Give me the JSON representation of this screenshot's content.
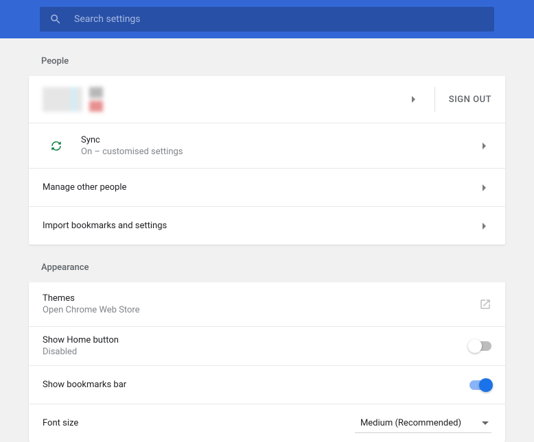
{
  "search": {
    "placeholder": "Search settings"
  },
  "sections": {
    "people": {
      "header": "People",
      "sign_out": "SIGN OUT",
      "sync": {
        "title": "Sync",
        "subtitle": "On – customised settings"
      },
      "manage_other": "Manage other people",
      "import_bookmarks": "Import bookmarks and settings"
    },
    "appearance": {
      "header": "Appearance",
      "themes": {
        "title": "Themes",
        "subtitle": "Open Chrome Web Store"
      },
      "home_button": {
        "title": "Show Home button",
        "subtitle": "Disabled"
      },
      "bookmarks_bar": {
        "title": "Show bookmarks bar"
      },
      "font_size": {
        "title": "Font size",
        "value": "Medium (Recommended)"
      }
    }
  }
}
